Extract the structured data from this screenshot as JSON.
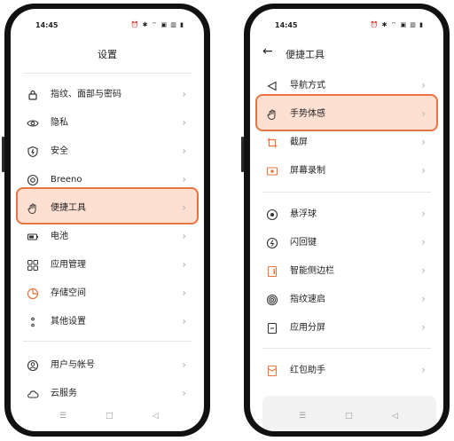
{
  "status": {
    "time": "14:45",
    "icons": "⏰ ✱ ⌔ ▣ ▥ ▮"
  },
  "nav": {
    "menu": "☰",
    "home": "□",
    "back": "◁"
  },
  "left": {
    "title": "设置",
    "items": [
      {
        "label": "指纹、面部与密码",
        "icon": "lock-icon"
      },
      {
        "label": "隐私",
        "icon": "privacy-eye-icon"
      },
      {
        "label": "安全",
        "icon": "shield-icon"
      },
      {
        "label": "Breeno",
        "icon": "breeno-icon"
      },
      {
        "label": "便捷工具",
        "icon": "hand-icon"
      },
      {
        "label": "电池",
        "icon": "battery-icon"
      },
      {
        "label": "应用管理",
        "icon": "apps-grid-icon"
      },
      {
        "label": "存储空间",
        "icon": "pie-chart-icon"
      },
      {
        "label": "其他设置",
        "icon": "more-dots-icon"
      },
      {
        "label": "用户与帐号",
        "icon": "user-icon"
      },
      {
        "label": "云服务",
        "icon": "cloud-icon"
      }
    ]
  },
  "right": {
    "title": "便捷工具",
    "items": [
      {
        "label": "导航方式",
        "icon": "navigation-icon"
      },
      {
        "label": "手势体感",
        "icon": "hand-gesture-icon"
      },
      {
        "label": "截屏",
        "icon": "crop-icon"
      },
      {
        "label": "屏幕录制",
        "icon": "screen-record-icon"
      },
      {
        "label": "悬浮球",
        "icon": "floating-ball-icon"
      },
      {
        "label": "闪回键",
        "icon": "flashback-icon"
      },
      {
        "label": "智能侧边栏",
        "icon": "sidebar-icon"
      },
      {
        "label": "指纹速启",
        "icon": "fingerprint-icon"
      },
      {
        "label": "应用分屏",
        "icon": "split-screen-icon"
      },
      {
        "label": "红包助手",
        "icon": "red-envelope-icon"
      }
    ]
  },
  "colors": {
    "accent": "#e9743f",
    "highlight_bg": "#fde0d2",
    "icon": "#333333",
    "record": "#e9743f"
  }
}
